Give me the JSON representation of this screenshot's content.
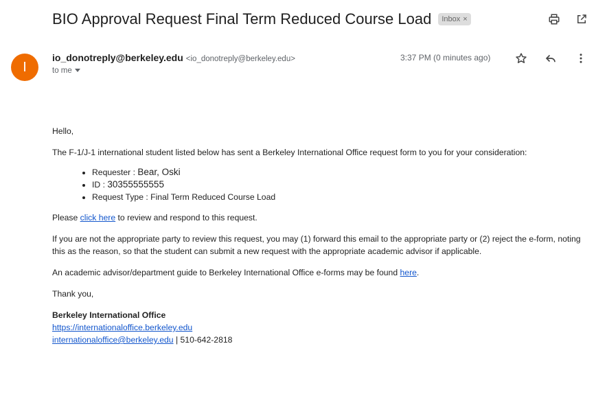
{
  "email": {
    "subject": "BIO Approval Request Final Term Reduced Course Load",
    "label_chip": "Inbox",
    "label_chip_close": "×",
    "avatar_letter": "I",
    "avatar_color": "#ef6c00",
    "sender_name": "io_donotreply@berkeley.edu",
    "sender_email": "<io_donotreply@berkeley.edu>",
    "to_text": "to me",
    "timestamp": "3:37 PM (0 minutes ago)",
    "icons": {
      "print": "printer-icon",
      "popout": "open-in-new-window-icon",
      "star": "star-icon",
      "reply": "reply-icon",
      "more": "more-vertical-icon",
      "to_dropdown": "caret-down-icon"
    }
  },
  "body": {
    "greeting": "Hello,",
    "intro": "The F-1/J-1 international student listed below has sent a Berkeley International Office request form to you for your consideration:",
    "details": [
      {
        "label": "Requester : ",
        "value": "Bear, Oski"
      },
      {
        "label": "ID : ",
        "value": "30355555555"
      },
      {
        "label": "Request Type : Final Term Reduced Course Load",
        "value": ""
      }
    ],
    "please_prefix": "Please ",
    "click_here": "click here",
    "please_suffix": " to review and respond to this request.",
    "not_appropriate": "If you are not the appropriate party to review this request, you may (1) forward this email to the appropriate party or (2) reject the e-form, noting this as the reason, so that the student can submit a new request with the appropriate academic advisor if applicable.",
    "guide_prefix": "An academic advisor/department guide to Berkeley International Office e-forms may be found ",
    "guide_link": "here",
    "guide_suffix": ".",
    "thanks": "Thank you,",
    "sig_name": "Berkeley International Office",
    "sig_url": "https://internationaloffice.berkeley.edu",
    "sig_email": "internationaloffice@berkeley.edu",
    "sig_phone": " | 510-642-2818"
  },
  "colors": {
    "link": "#1155cc",
    "chip_bg": "#dddddd",
    "meta_text": "#5f6368"
  }
}
